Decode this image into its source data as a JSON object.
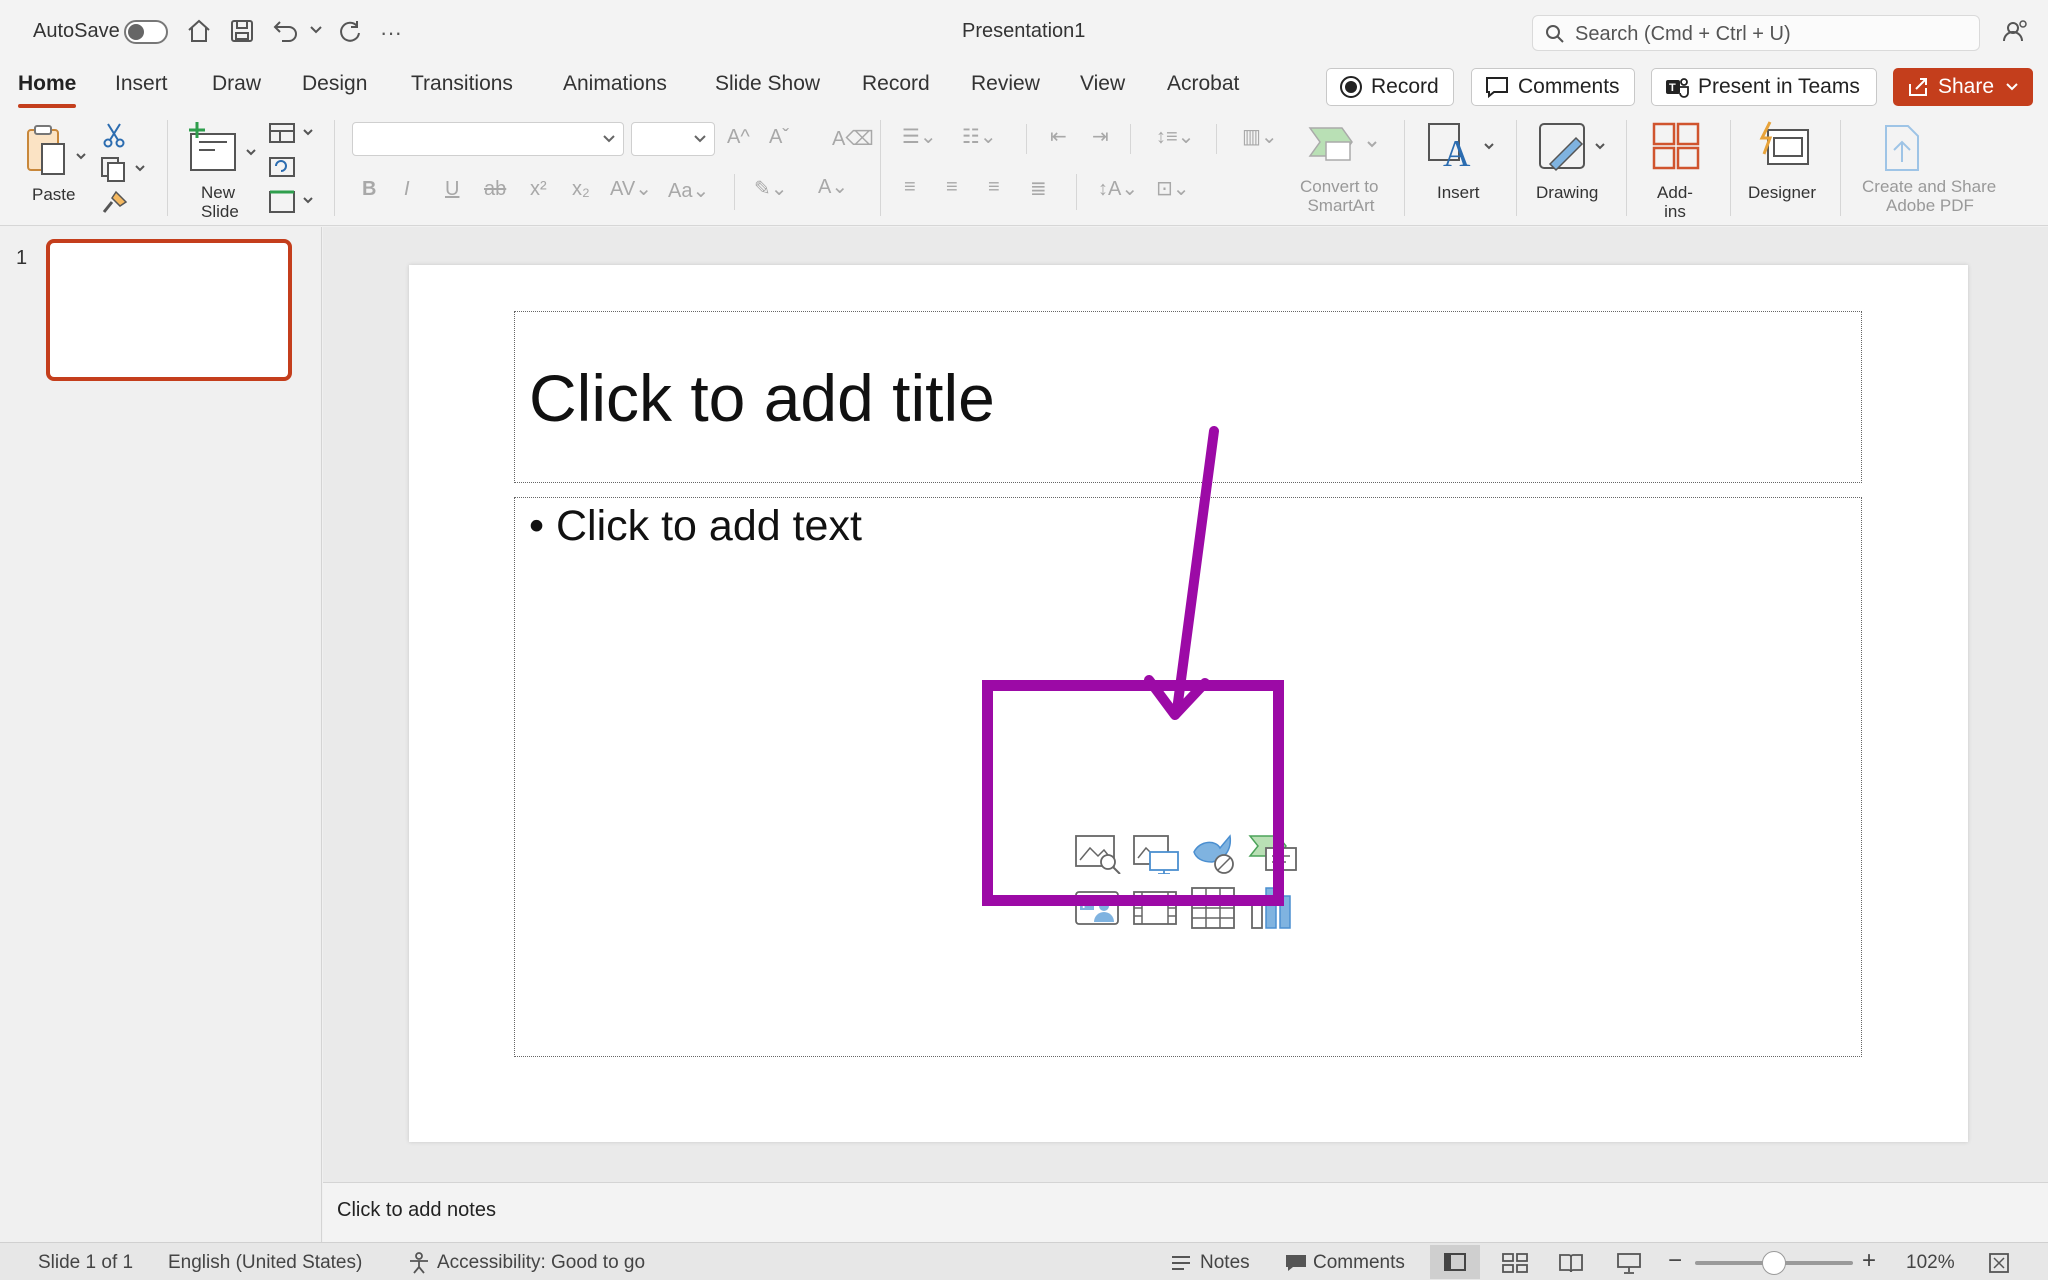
{
  "titlebar": {
    "autosave_label": "AutoSave",
    "document_title": "Presentation1",
    "search_placeholder": "Search (Cmd + Ctrl + U)"
  },
  "tabs": [
    {
      "label": "Home",
      "active": true
    },
    {
      "label": "Insert"
    },
    {
      "label": "Draw"
    },
    {
      "label": "Design"
    },
    {
      "label": "Transitions"
    },
    {
      "label": "Animations"
    },
    {
      "label": "Slide Show"
    },
    {
      "label": "Record"
    },
    {
      "label": "Review"
    },
    {
      "label": "View"
    },
    {
      "label": "Acrobat"
    }
  ],
  "actions": {
    "record": "Record",
    "comments": "Comments",
    "present_in_teams": "Present in Teams",
    "share": "Share"
  },
  "ribbon": {
    "paste": "Paste",
    "new_slide_1": "New",
    "new_slide_2": "Slide",
    "convert_1": "Convert to",
    "convert_2": "SmartArt",
    "insert": "Insert",
    "drawing": "Drawing",
    "addins": "Add-ins",
    "designer": "Designer",
    "acrobat_1": "Create and Share",
    "acrobat_2": "Adobe PDF"
  },
  "thumbnails": [
    {
      "number": "1"
    }
  ],
  "slide": {
    "title_placeholder": "Click to add title",
    "body_placeholder": "• Click to add text"
  },
  "notes": {
    "placeholder": "Click to add notes"
  },
  "status": {
    "slide_count": "Slide 1 of 1",
    "language": "English (United States)",
    "accessibility": "Accessibility: Good to go",
    "notes": "Notes",
    "comments": "Comments",
    "zoom": "102%"
  },
  "colors": {
    "accent": "#c43e1c",
    "annotation": "#9c0aa6"
  }
}
